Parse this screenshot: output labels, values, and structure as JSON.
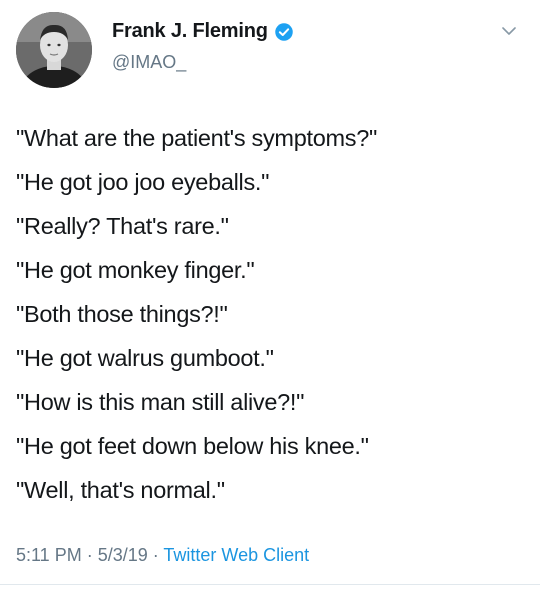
{
  "author": {
    "display_name": "Frank J. Fleming",
    "handle": "@IMAO_",
    "verified": true
  },
  "tweet_lines": [
    "\"What are the patient's symptoms?\"",
    "\"He got joo joo eyeballs.\"",
    "\"Really? That's rare.\"",
    "\"He got monkey finger.\"",
    "\"Both those things?!\"",
    "\"He got walrus gumboot.\"",
    "\"How is this man still alive?!\"",
    "\"He got feet down below his knee.\"",
    "\"Well, that's normal.\""
  ],
  "meta": {
    "time": "5:11 PM",
    "separator": " · ",
    "date": "5/3/19",
    "client": "Twitter Web Client"
  },
  "colors": {
    "text": "#14171a",
    "secondary": "#657786",
    "accent": "#1b95e0"
  },
  "icons": {
    "verified": "verified-badge-icon",
    "more": "chevron-down-icon"
  }
}
